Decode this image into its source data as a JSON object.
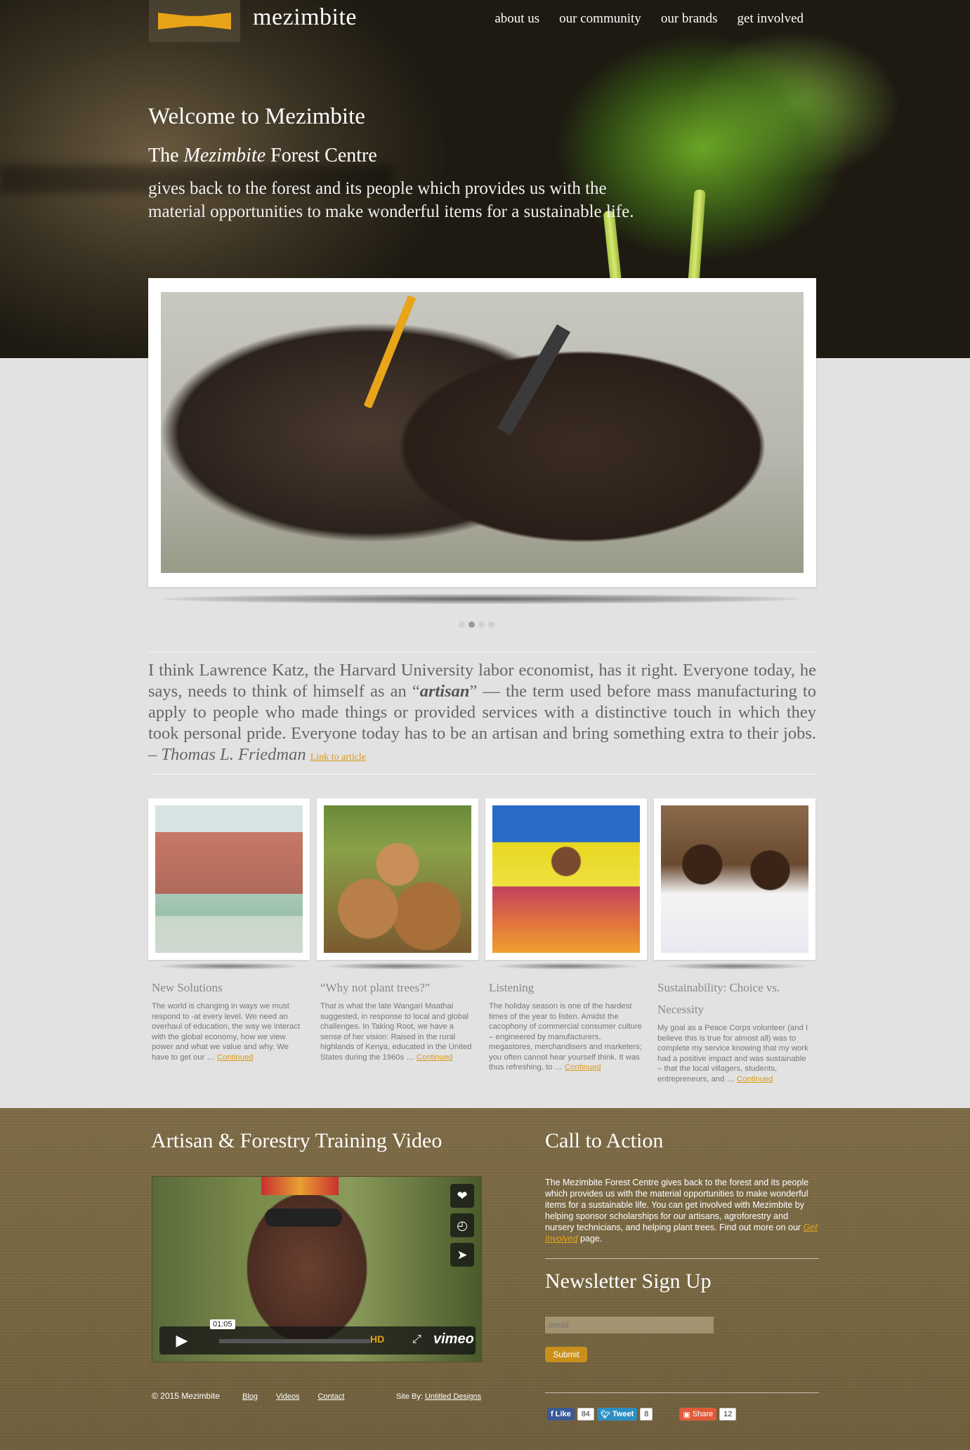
{
  "brand": {
    "name": "mezimbite"
  },
  "nav": [
    {
      "label": "about us"
    },
    {
      "label": "our community"
    },
    {
      "label": "our brands"
    },
    {
      "label": "get involved"
    }
  ],
  "hero": {
    "title": "Welcome to Mezimbite",
    "subtitle_pre": "The ",
    "subtitle_em": "Mezimbite",
    "subtitle_post": " Forest Centre",
    "text": "gives back to the forest and its people which provides us with the material opportunities to make wonderful items for a sustainable life."
  },
  "slider": {
    "slide_count": 4,
    "active_index": 1
  },
  "quote": {
    "part1": "I think Lawrence Katz, the Harvard University labor economist, has it right. Everyone today, he says, needs to think of himself as an “",
    "emphasis": "artisan",
    "part2": "” — the term used before mass manufacturing to apply to people who made things or provided services with a distinctive touch in which they took personal pride. Everyone today has to be an artisan and bring something extra to their jobs. – ",
    "author": "Thomas L. Friedman",
    "link": "Link to article"
  },
  "cards": [
    {
      "title": "New Solutions",
      "text": "The world is changing in ways we must respond to -at every level. We need an overhaul of education, the way we interact with the global economy, how we view power and what we value and why. We have to get our … ",
      "more": "Continued"
    },
    {
      "title": "“Why not plant trees?”",
      "text": "That is what the late Wangari Maathai suggested, in response to local and global challenges. In Taking Root, we have a sense of her vision: Raised in the rural highlands of Kenya, educated in the United States during the 1960s … ",
      "more": "Continued"
    },
    {
      "title": "Listening",
      "text": "The holiday season is one of the hardest times of the year to listen. Amidst the cacophony of commercial consumer culture – engineered by manufacturers, megastores, merchandisers and marketers; you often cannot hear yourself think. It was thus refreshing, to … ",
      "more": "Continued"
    },
    {
      "title": "Sustainability: Choice vs. Necessity",
      "text": "My goal as a Peace Corps volunteer (and I believe this is true for almost all) was to complete my service knowing that my work had a positive impact and was sustainable – that the local villagers, students, entrepreneurs, and … ",
      "more": "Continued"
    }
  ],
  "video": {
    "heading": "Artisan & Forestry Training Video",
    "time": "01:05",
    "hd": "HD",
    "provider": "vimeo"
  },
  "cta": {
    "heading": "Call to Action",
    "text": "The Mezimbite Forest Centre gives back to the forest and its people which provides us with the material opportunities to make wonderful items for a sustainable life. You can get involved with Mezimbite by helping sponsor scholarships for our artisans, agroforestry and nursery technicians, and helping plant trees. Find out more on our ",
    "link": "Get Involved",
    "text_end": " page."
  },
  "newsletter": {
    "heading": "Newsletter Sign Up",
    "placeholder": "email",
    "submit": "Submit"
  },
  "footer": {
    "copyright": "© 2015 Mezimbite",
    "links": [
      "Blog",
      "Videos",
      "Contact"
    ],
    "siteby_label": "Site By: ",
    "siteby_link": "Untitled Designs"
  },
  "social": {
    "like": "Like",
    "like_count": "84",
    "tweet": "Tweet",
    "tweet_count": "8",
    "share": "Share",
    "share_count": "12"
  },
  "colors": {
    "accent": "#e8a418",
    "footer_bg": "#76653f",
    "page_bg": "#e2e2e2"
  },
  "icons": [
    "heart-icon",
    "clock-icon",
    "send-icon",
    "play-icon",
    "fullscreen-icon"
  ]
}
